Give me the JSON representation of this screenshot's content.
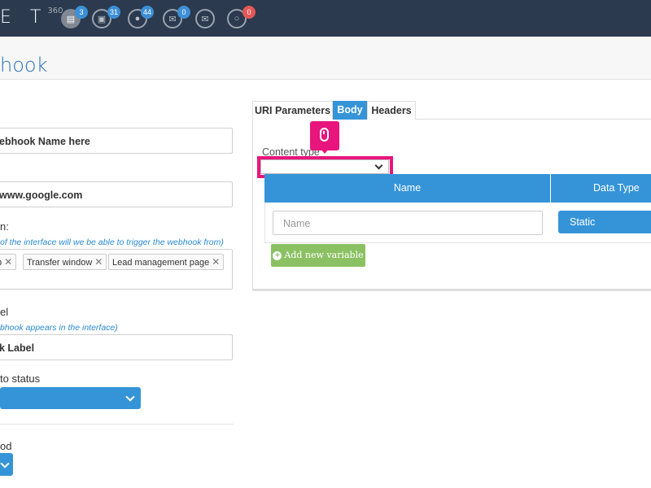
{
  "app": {
    "logo": "E T",
    "logo_sup": "360"
  },
  "topbar": {
    "icons": [
      {
        "name": "document-icon",
        "badge": "3"
      },
      {
        "name": "image-icon",
        "badge": "31"
      },
      {
        "name": "chat-icon",
        "badge": "44"
      },
      {
        "name": "mail-icon",
        "badge": "0"
      },
      {
        "name": "open-mail-icon",
        "badge": ""
      },
      {
        "name": "comment-icon",
        "badge": "0"
      }
    ]
  },
  "page": {
    "title": "hook"
  },
  "form": {
    "name_value": "ebhook Name here",
    "url_value": "www.google.com",
    "trigger_label": "n:",
    "trigger_hint": "of the interface will we be able to trigger the webhook from)",
    "trigger_tags": [
      "p",
      "Transfer window",
      "Lead management page"
    ],
    "tag_remove": "✕",
    "label_label": "el",
    "label_hint": "bhook appears in the interface)",
    "label_value": "k Label",
    "status_label": "to status",
    "method_label": "od"
  },
  "tabs": [
    {
      "label": "URI Parameters",
      "active": false
    },
    {
      "label": "Body",
      "active": true
    },
    {
      "label": "Headers",
      "active": false
    }
  ],
  "body": {
    "content_type_label": "Content type",
    "table_headers": {
      "name": "Name",
      "data_type": "Data Type"
    },
    "name_placeholder": "Name",
    "data_type_value": "Static",
    "add_variable": "Add new variable"
  },
  "colors": {
    "accent": "#3594d8",
    "highlight": "#e8157d",
    "topbar": "#2b3a4e",
    "success": "#8bc163"
  }
}
